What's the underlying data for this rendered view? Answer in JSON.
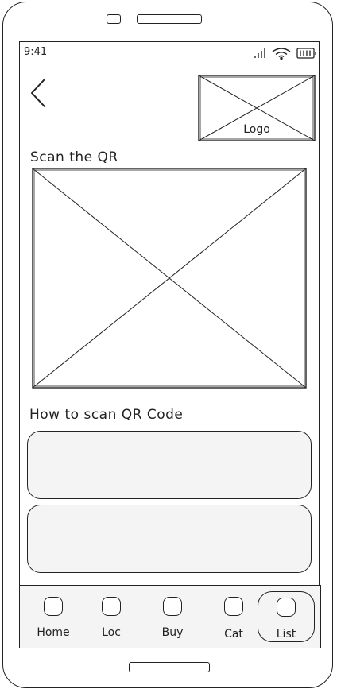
{
  "status_bar": {
    "time": "9:41"
  },
  "header": {
    "logo_label": "Logo"
  },
  "scan_section": {
    "title": "Scan the QR"
  },
  "howto_section": {
    "title": "How to scan QR Code"
  },
  "tabs": [
    {
      "label": "Home",
      "icon": "home-icon",
      "active": false
    },
    {
      "label": "Loc",
      "icon": "location-icon",
      "active": false
    },
    {
      "label": "Buy",
      "icon": "buy-icon",
      "active": false
    },
    {
      "label": "Cat",
      "icon": "category-icon",
      "active": false
    },
    {
      "label": "List",
      "icon": "list-icon",
      "active": true
    }
  ]
}
